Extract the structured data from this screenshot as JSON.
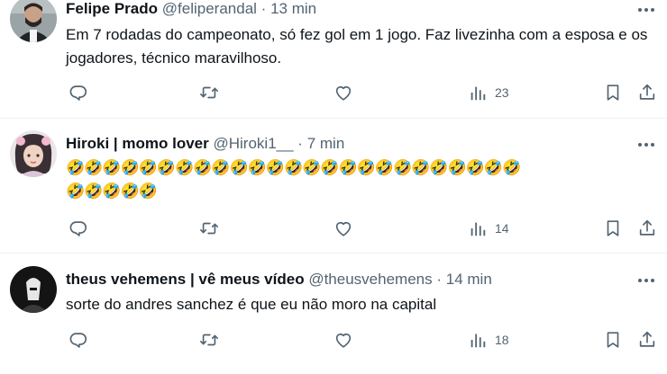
{
  "tweets": [
    {
      "name": "Felipe Prado",
      "handle": "@feliperandal",
      "separator": "·",
      "time": "13 min",
      "text": "Em 7 rodadas do campeonato, só fez gol em 1 jogo. Faz livezinha com a esposa e os jogadores, técnico maravilhoso.",
      "views": "23"
    },
    {
      "name": "Hiroki | momo lover",
      "handle": "@Hiroki1__",
      "separator": "·",
      "time": "7 min",
      "emoji_line1": "🤣🤣🤣🤣🤣🤣🤣🤣🤣🤣🤣🤣🤣🤣🤣🤣🤣🤣🤣🤣🤣🤣🤣🤣🤣",
      "emoji_line2": "🤣🤣🤣🤣🤣",
      "views": "14"
    },
    {
      "name": "theus vehemens | vê meus vídeo",
      "handle": "@theusvehemens",
      "separator": "·",
      "time": "14 min",
      "text": "sorte do andres sanchez é que eu não moro na capital",
      "views": "18"
    }
  ],
  "icons": {
    "more": "more-icon",
    "reply": "reply-icon",
    "retweet": "retweet-icon",
    "like": "heart-icon",
    "views": "views-icon",
    "bookmark": "bookmark-icon",
    "share": "share-icon"
  },
  "colors": {
    "text": "#0f1419",
    "secondary": "#536471",
    "divider": "#eff3f4"
  }
}
